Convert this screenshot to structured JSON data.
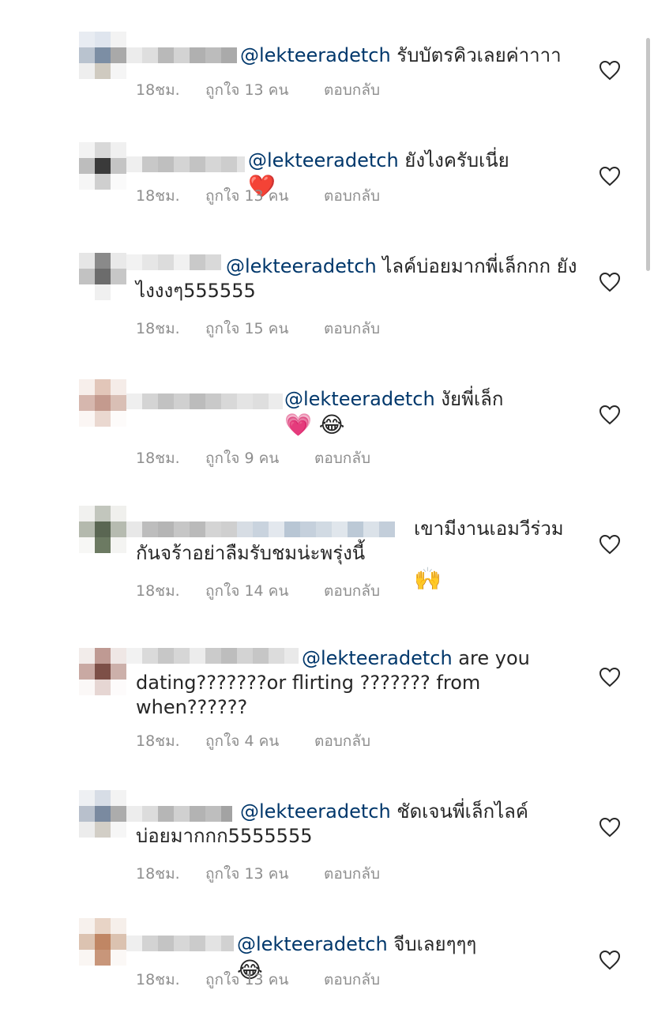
{
  "comments": [
    {
      "mention": "@lekteeradetch",
      "text": " รับบัตรคิวเลยค่าาาา",
      "emoji": "",
      "time": "18ชม.",
      "likes": "ถูกใจ 13 คน",
      "reply": "ตอบกลับ"
    },
    {
      "mention": "@lekteeradetch",
      "text": " ยังไงครับเนี่ย",
      "emoji": "❤️",
      "time": "18ชม.",
      "likes": "ถูกใจ 13 คน",
      "reply": "ตอบกลับ"
    },
    {
      "mention": "@lekteeradetch",
      "text": " ไลค์บ่อยมากพี่เล็กกก ยังไงงงๆ555555",
      "emoji": "",
      "time": "18ชม.",
      "likes": "ถูกใจ 15 คน",
      "reply": "ตอบกลับ"
    },
    {
      "mention": "@lekteeradetch",
      "text": " งัยพี่เล็ก",
      "emoji": "💗 😂",
      "time": "18ชม.",
      "likes": "ถูกใจ 9 คน",
      "reply": "ตอบกลับ"
    },
    {
      "mention": "",
      "text": "เขามีงานเอมวีร่วม กันจร้าอย่าลืมรับชมน่ะพรุ่งนี้",
      "emoji": "🙌",
      "time": "18ชม.",
      "likes": "ถูกใจ 14 คน",
      "reply": "ตอบกลับ"
    },
    {
      "mention": "@lekteeradetch",
      "text": " are you dating???????or flirting ??????? from when??????",
      "emoji": "",
      "time": "18ชม.",
      "likes": "ถูกใจ 4 คน",
      "reply": "ตอบกลับ"
    },
    {
      "mention": "@lekteeradetch",
      "text": " ชัดเจนพี่เล็กไลค์ บ่อยมากกก5555555",
      "emoji": "",
      "time": "18ชม.",
      "likes": "ถูกใจ 13 คน",
      "reply": "ตอบกลับ"
    },
    {
      "mention": "@lekteeradetch",
      "text": " จีบเลยๆๆๆ",
      "emoji": "😂",
      "time": "18ชม.",
      "likes": "ถูกใจ 13 คน",
      "reply": "ตอบกลับ"
    }
  ],
  "colors": {
    "text": "#262626",
    "mention": "#00376b",
    "meta": "#8e8e8e"
  },
  "icons": {
    "like": "heart-outline-icon"
  }
}
